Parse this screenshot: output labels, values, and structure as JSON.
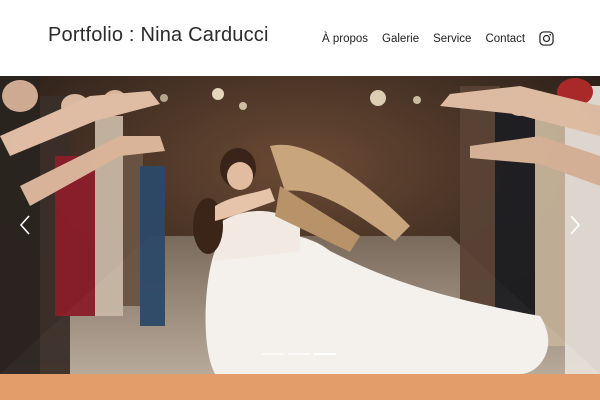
{
  "header": {
    "brand": "Portfolio : Nina Carducci",
    "nav": [
      {
        "label": "À propos"
      },
      {
        "label": "Galerie"
      },
      {
        "label": "Service"
      },
      {
        "label": "Contact"
      }
    ],
    "social_icon": "instagram-icon"
  },
  "carousel": {
    "slides_count": 3,
    "active_slide": 3,
    "prev_icon": "chevron-left-icon",
    "next_icon": "chevron-right-icon"
  },
  "colors": {
    "accent_band": "#e39d6b",
    "text": "#222222"
  }
}
